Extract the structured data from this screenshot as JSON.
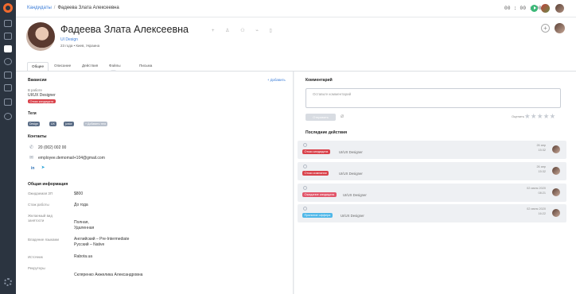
{
  "breadcrumb": {
    "parent": "Кандидаты",
    "separator": "/",
    "current": "Фадеева Злата Алексеевна"
  },
  "topbar": {
    "timer": "00 : 00 : 00"
  },
  "profile": {
    "name": "Фадеева Злата Алексеевна",
    "role": "UI Design",
    "location": "23 года • Киев, Украина"
  },
  "tabs": [
    {
      "label": "Общее"
    },
    {
      "label": "Описание"
    },
    {
      "label": "Действия"
    },
    {
      "label": "Файлы",
      "count": "0"
    },
    {
      "label": "Письма"
    }
  ],
  "vacancies": {
    "title": "Вакансии",
    "add_label": "+ Добавить",
    "status_label": "В работе",
    "vacancy_name": "UI/UX Designer",
    "badge": "Отказ кандидата"
  },
  "tags": {
    "title": "Теги",
    "items": [
      "Design",
      "UX",
      "junior"
    ],
    "add_label": "+ Добавить теги"
  },
  "contacts": {
    "title": "Контакты",
    "phone": "20 (002) 002 00",
    "email": "employee.demomail+104@gmail.com",
    "linkedin": "in"
  },
  "general": {
    "title": "Общая информация",
    "rows": [
      {
        "label": "Ожидаемая ЗП",
        "value": "$800"
      },
      {
        "label": "Стаж работы",
        "value": "До года"
      },
      {
        "label": "Желаемый вид занятости",
        "value": "Полная,\nУдаленная"
      },
      {
        "label": "Владение языками",
        "value": "Английский – Pre-Intermediate\nРусский – Native"
      },
      {
        "label": "Источник",
        "value": "Rabota.ua"
      },
      {
        "label": "Рекрутеры",
        "value": ""
      }
    ],
    "recruiter": "Скляренко Анжелика Александровна"
  },
  "comment": {
    "title": "Комментарий",
    "placeholder": "Оставьте комментарий",
    "send_label": "Отправить",
    "rate_label": "Оценить"
  },
  "recent": {
    "title": "Последние действия",
    "items": [
      {
        "badge": "Отказ кандидата",
        "color": "#d9424b",
        "vacancy": "UI/UX Designer",
        "date": "26 апр",
        "time": "15:32"
      },
      {
        "badge": "Отказ компании",
        "color": "#d9424b",
        "vacancy": "UI/UX Designer",
        "date": "26 апр",
        "time": "15:32"
      },
      {
        "badge": "Ожидание кандидата",
        "color": "#e2566a",
        "vacancy": "UI/UX Designer",
        "date": "02 июня 2020",
        "time": "08:21"
      },
      {
        "badge": "Принятие оффера",
        "color": "#4fb7e8",
        "vacancy": "UI/UX Designer",
        "date": "02 июня 2020",
        "time": "16:22"
      }
    ]
  }
}
